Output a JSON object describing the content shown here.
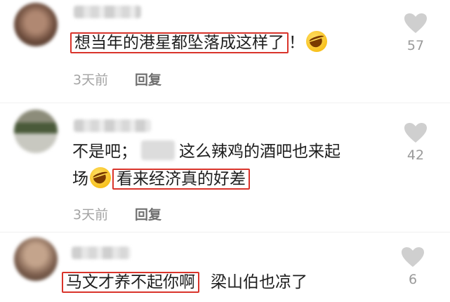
{
  "comments": [
    {
      "text_highlight": "想当年的港星都坠落成这样了",
      "text_tail": "！",
      "time": "3天前",
      "reply": "回复",
      "likes": "57"
    },
    {
      "line1_prefix": "不是吧；",
      "line1_suffix": "这么辣鸡的酒吧也来起",
      "line2_prefix": "场",
      "text_highlight": "看来经济真的好差",
      "time": "3天前",
      "reply": "回复",
      "likes": "42"
    },
    {
      "text_highlight": "马文才养不起你啊",
      "text_tail": "梁山伯也凉了",
      "likes": "6"
    }
  ],
  "colors": {
    "highlight_border": "#d9342b",
    "like_icon": "#cfcfcf",
    "meta_text": "#a4a4a4"
  },
  "icons": {
    "like": "heart-icon",
    "emoji": "laughing-emoji-icon"
  }
}
